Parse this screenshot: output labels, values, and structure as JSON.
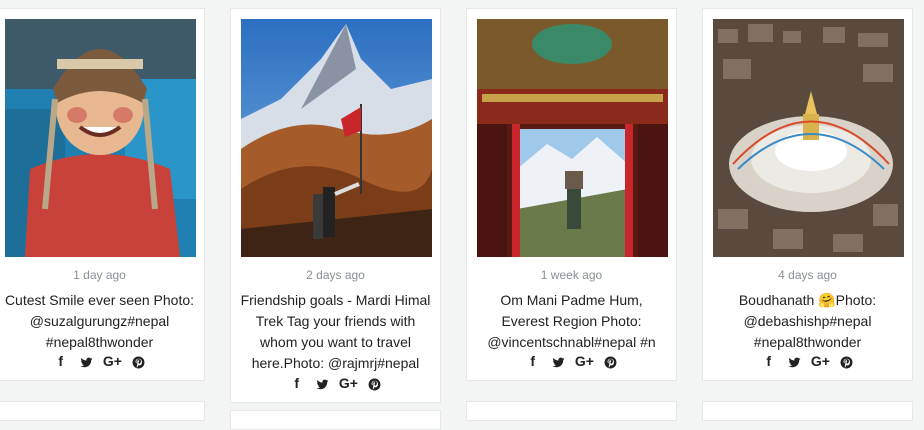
{
  "posts": [
    {
      "time": "1 day ago",
      "caption": "Cutest Smile ever seen Photo: @suzalgurungz#nepal #nepal8thwonder"
    },
    {
      "time": "2 days ago",
      "caption": "Friendship goals - Mardi Himal Trek Tag your friends with whom you want to travel here.Photo: @rajmrj#nepal"
    },
    {
      "time": "1 week ago",
      "caption": "Om Mani Padme Hum, Everest Region Photo: @vincentschnabl#nepal #n"
    },
    {
      "time": "4 days ago",
      "caption": "Boudhanath 🤗Photo: @debashishp#nepal #nepal8thwonder"
    }
  ],
  "share": {
    "facebook": "f",
    "google": "G+"
  },
  "icons": [
    "facebook-icon",
    "twitter-icon",
    "google-plus-icon",
    "pinterest-icon"
  ]
}
